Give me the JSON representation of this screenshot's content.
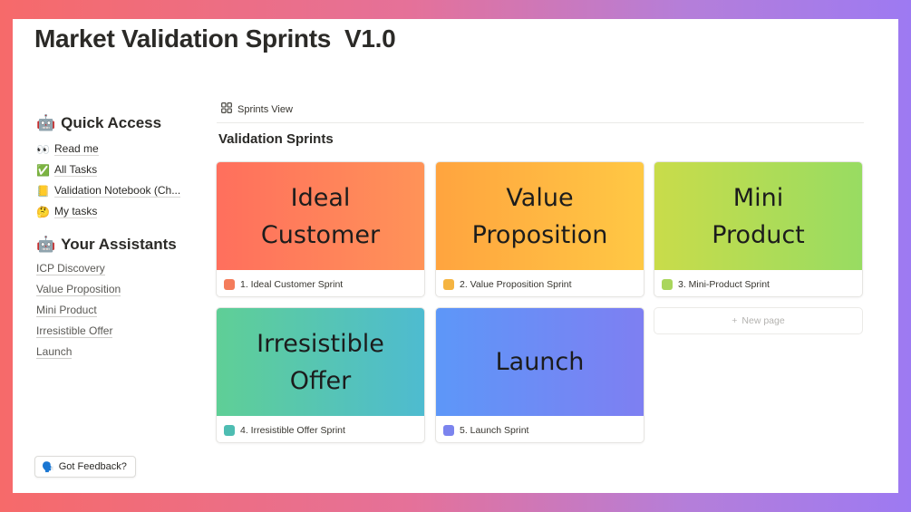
{
  "title": "Market Validation Sprints  V1.0",
  "quick_access": {
    "icon": "🤖",
    "heading": "Quick Access",
    "items": [
      {
        "emoji": "👀",
        "label": "Read me"
      },
      {
        "emoji": "✅",
        "label": "All Tasks"
      },
      {
        "emoji": "📒",
        "label": "Validation Notebook (Ch..."
      },
      {
        "emoji": "🤔",
        "label": "My tasks"
      }
    ]
  },
  "assistants": {
    "icon": "🤖",
    "heading": "Your Assistants",
    "items": [
      "ICP Discovery",
      "Value Proposition",
      "Mini Product",
      "Irresistible Offer",
      "Launch"
    ]
  },
  "feedback": {
    "emoji": "🗣️",
    "label": "Got Feedback?"
  },
  "view_tab": {
    "label": "Sprints View",
    "icon": "grid-icon"
  },
  "gallery_title": "Validation Sprints",
  "cards": [
    {
      "cover_line1": "Ideal",
      "cover_line2": "Customer",
      "title": "1. Ideal Customer Sprint",
      "color": "#ff7a5c"
    },
    {
      "cover_line1": "Value",
      "cover_line2": "Proposition",
      "title": "2. Value Proposition Sprint",
      "color": "#ffb642"
    },
    {
      "cover_line1": "Mini",
      "cover_line2": "Product",
      "title": "3. Mini-Product Sprint",
      "color": "#b4dc55"
    },
    {
      "cover_line1": "Irresistible",
      "cover_line2": "Offer",
      "title": "4. Irresistible Offer Sprint",
      "color": "#56c5b3"
    },
    {
      "cover_line1": "Launch",
      "cover_line2": "",
      "title": "5. Launch Sprint",
      "color": "#6d8bf5"
    }
  ],
  "new_page": {
    "icon": "+",
    "label": "New page"
  }
}
